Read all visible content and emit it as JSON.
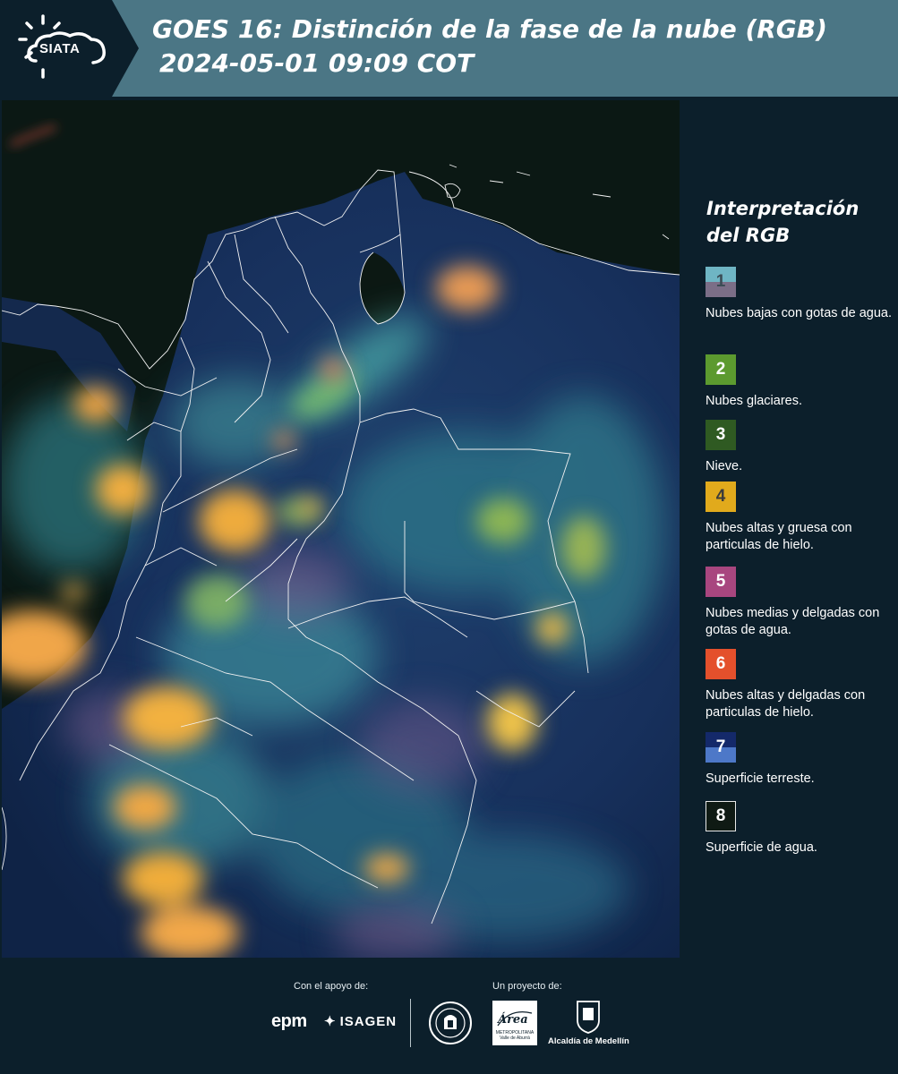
{
  "header": {
    "logo_text": "SIATA",
    "title_line1": "GOES 16: Distinción de la fase de la nube (RGB)",
    "title_line2": "2024-05-01 09:09 COT",
    "background_color": "#4b7685"
  },
  "legend": {
    "title": "Interpretación del RGB",
    "items": [
      {
        "number": "1",
        "label": "Nubes bajas con gotas de agua.",
        "colors": [
          "#6fb5c4",
          "#7b6e87"
        ]
      },
      {
        "number": "2",
        "label": "Nubes glaciares.",
        "colors": [
          "#5c9a2f"
        ]
      },
      {
        "number": "3",
        "label": "Nieve.",
        "colors": [
          "#2f5a22"
        ]
      },
      {
        "number": "4",
        "label": "Nubes altas y gruesa con particulas de hielo.",
        "colors": [
          "#e1aa1c"
        ]
      },
      {
        "number": "5",
        "label": "Nubes medias y delgadas con gotas de agua.",
        "colors": [
          "#a8467f"
        ]
      },
      {
        "number": "6",
        "label": "Nubes altas y delgadas con particulas de hielo.",
        "colors": [
          "#e4502c"
        ]
      },
      {
        "number": "7",
        "label": "Superficie terreste.",
        "colors": [
          "#14296a",
          "#4d78c8"
        ]
      },
      {
        "number": "8",
        "label": "Superficie de agua.",
        "colors": [
          "#0f1a14"
        ]
      }
    ]
  },
  "footer": {
    "support_label": "Con el apoyo de:",
    "project_label": "Un proyecto de:",
    "sponsor_1": "epm",
    "sponsor_2": "ISAGEN",
    "partner_2": "Área",
    "partner_2_sub": "METROPOLITANA Valle de Aburrá",
    "partner_3": "Alcaldía de Medellín"
  }
}
